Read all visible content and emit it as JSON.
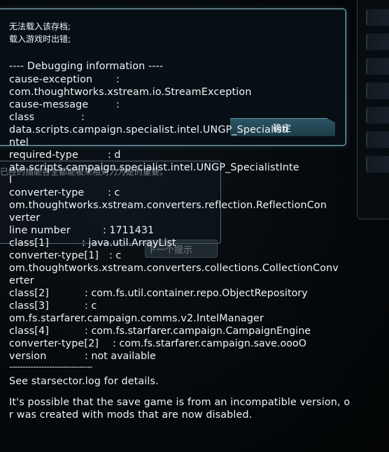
{
  "dialog": {
    "title_line1": "无法载入该存档;",
    "title_line2": "载入游戏时出错;",
    "confirm_label": "确定"
  },
  "ghost": {
    "text": "已经的描能各全都能被来相对力为是的重要。",
    "button_label": "下一个提示"
  },
  "debug": {
    "header": "---- Debugging information ----",
    "cause_exception_key": "cause-exception",
    "cause_exception_colon": ":",
    "cause_exception_value": "com.thoughtworks.xstream.io.StreamException",
    "cause_message_key": "cause-message",
    "cause_message_colon": ":",
    "class_key": "class",
    "class_colon": ":",
    "class_value_1": "data.scripts.campaign.specialist.intel.UNGP_Specialisti",
    "class_value_2": "ntel",
    "required_type_key": "required-type",
    "required_type_value_1": ": d",
    "required_type_value_2": "ata.scripts.campaign.specialist.intel.UNGP_SpecialistInte",
    "required_type_value_3": "l",
    "converter_type_key": "converter-type",
    "converter_type_value_1": ": c",
    "converter_type_value_2": "om.thoughtworks.xstream.converters.reflection.ReflectionCon",
    "converter_type_value_3": "verter",
    "line_number_key": "line number",
    "line_number_value": ": 1711431",
    "class1_key": "class[1]",
    "class1_value": ": java.util.ArrayList",
    "converter_type1_key": "converter-type[1]",
    "converter_type1_value_1": ": c",
    "converter_type1_value_2": "om.thoughtworks.xstream.converters.collections.CollectionConv",
    "converter_type1_value_3": "erter",
    "class2_key": "class[2]",
    "class2_value": ": com.fs.util.container.repo.ObjectRepository",
    "class3_key": "class[3]",
    "class3_value_1": ": c",
    "class3_value_2": "om.fs.starfarer.campaign.comms.v2.IntelManager",
    "class4_key": "class[4]",
    "class4_value": ": com.fs.starfarer.campaign.CampaignEngine",
    "converter_type2_key": "converter-type[2]",
    "converter_type2_value": ": com.fs.starfarer.campaign.save.oooO",
    "version_key": "version",
    "version_value": ": not available",
    "separator": "-------------------------------"
  },
  "footer": {
    "see_log": "See starsector.log for details.",
    "possible_1": "It's possible that the save game is from an incompatible version, o",
    "possible_2": "r was created with mods that are now disabled."
  }
}
